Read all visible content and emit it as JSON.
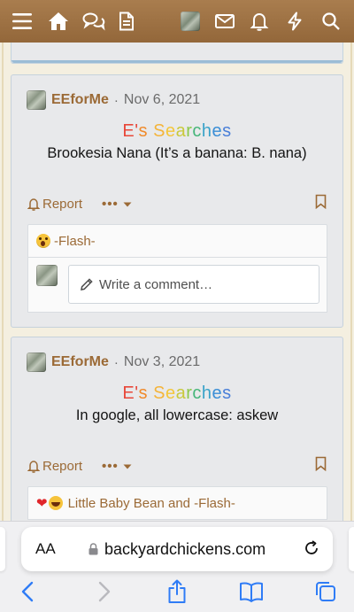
{
  "nav": {
    "icons": [
      "menu-icon",
      "home-icon",
      "chat-icon",
      "document-icon",
      "avatar",
      "mail-icon",
      "bell-icon",
      "bolt-icon",
      "search-icon"
    ]
  },
  "posts": [
    {
      "username": "EEforMe",
      "separator": "·",
      "date": "Nov 6, 2021",
      "title_letters": [
        "E",
        "'",
        "s",
        " ",
        "S",
        "e",
        "a",
        "r",
        "c",
        "h",
        "e",
        "s"
      ],
      "body": "Brookesia Nana (It’s a banana: B. nana)",
      "report_label": "Report",
      "more_label": "•••",
      "reactions_text": "-Flash-",
      "comment_placeholder": "Write a comment…"
    },
    {
      "username": "EEforMe",
      "separator": "·",
      "date": "Nov 3, 2021",
      "title_letters": [
        "E",
        "'",
        "s",
        " ",
        "S",
        "e",
        "a",
        "r",
        "c",
        "h",
        "e",
        "s"
      ],
      "body": "In google, all lowercase: askew",
      "report_label": "Report",
      "more_label": "•••",
      "reactions_text": "Little Baby Bean and -Flash-"
    }
  ],
  "title_colors": [
    "#e8483a",
    "#e8483a",
    "#f08a2a",
    "#ffffff",
    "#f4b43a",
    "#f4c63a",
    "#c9c93a",
    "#8cc84a",
    "#45b57a",
    "#3aa3c9",
    "#3a8ed6",
    "#4a7fd8"
  ],
  "safari": {
    "text_size_label": "AA",
    "url": "backyardchickens.com"
  },
  "colors": {
    "nav_brown": "#9e7142",
    "link_brown": "#9b6a36",
    "safari_blue": "#2f7cf6"
  }
}
